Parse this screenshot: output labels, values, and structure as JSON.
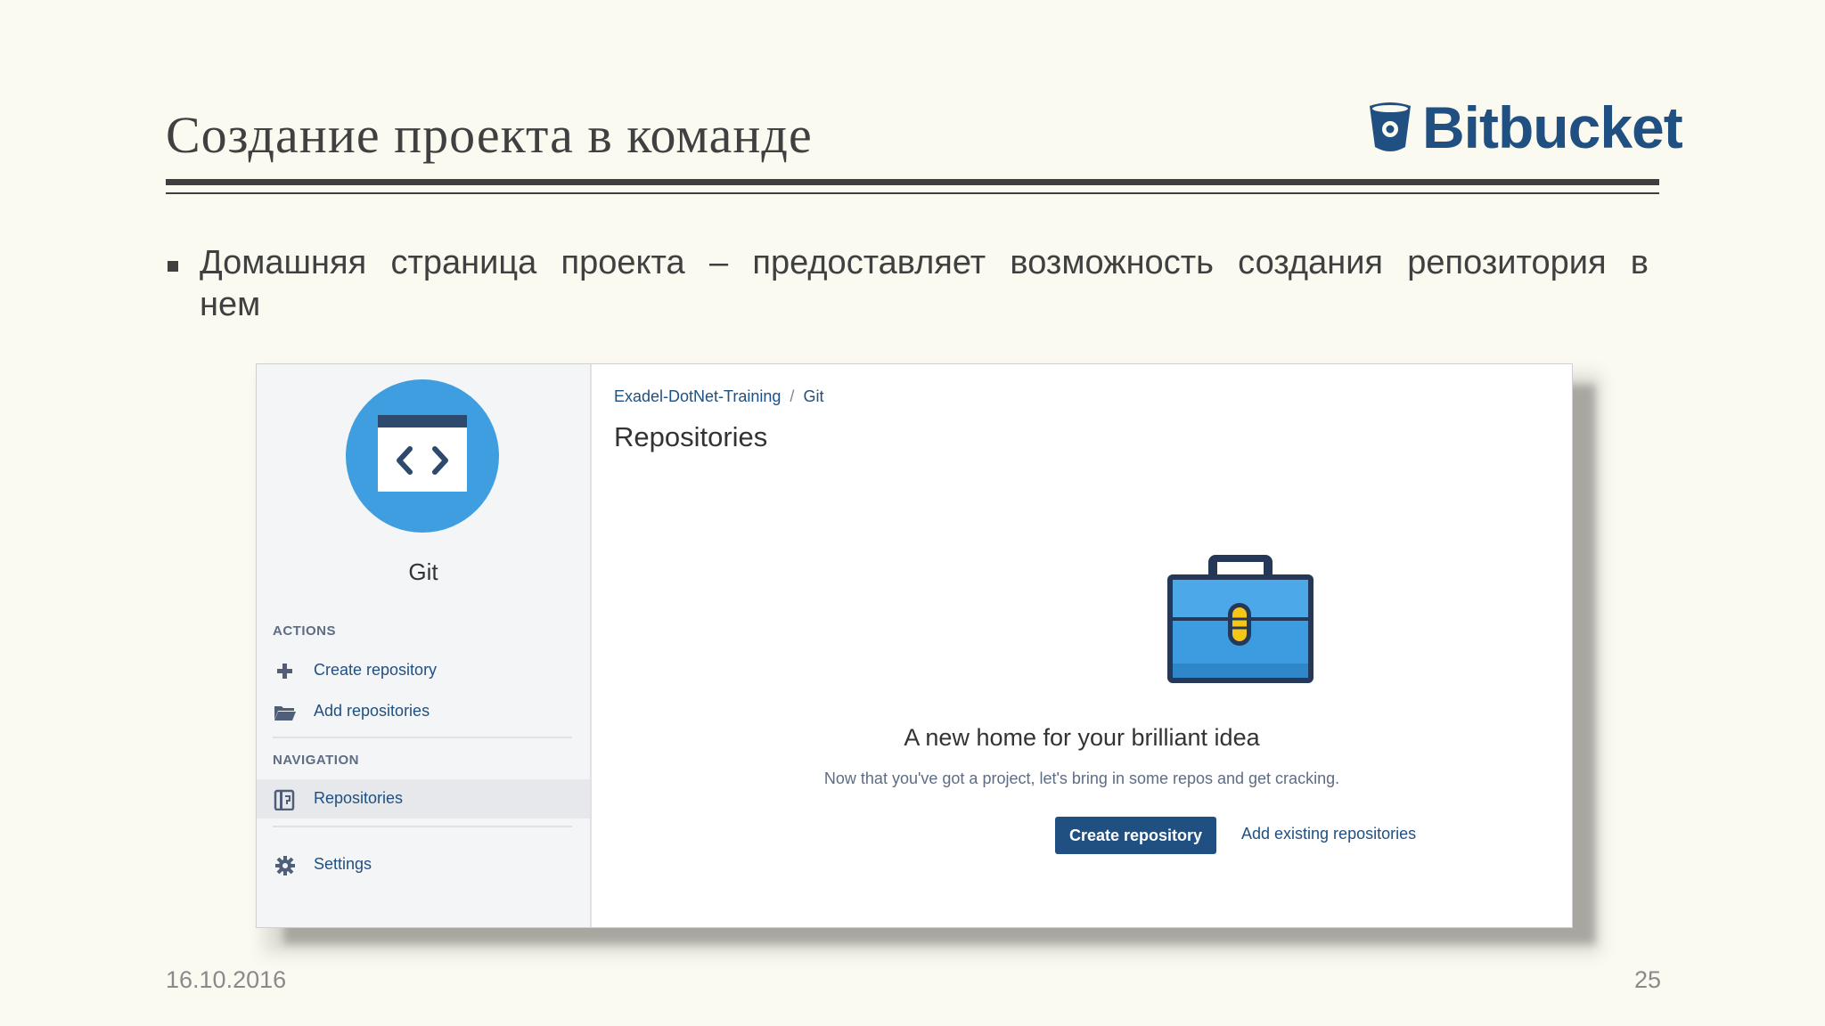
{
  "slide": {
    "title": "Создание проекта в команде",
    "logo_text": "Bitbucket",
    "bullet": "Домашняя страница проекта – предоставляет возможность создания репозитория в нем",
    "date": "16.10.2016",
    "page_number": "25"
  },
  "colors": {
    "brand_blue": "#205081",
    "avatar_blue": "#3f9ee0",
    "slide_background": "#fbfaf1"
  },
  "screenshot": {
    "sidebar": {
      "project_name": "Git",
      "avatar_icon": "code-folder-icon",
      "actions_heading": "ACTIONS",
      "actions": [
        {
          "label": "Create repository",
          "icon": "plus-icon"
        },
        {
          "label": "Add repositories",
          "icon": "folder-open-icon"
        }
      ],
      "navigation_heading": "NAVIGATION",
      "navigation": [
        {
          "label": "Repositories",
          "icon": "repository-icon",
          "active": true
        }
      ],
      "settings": {
        "label": "Settings",
        "icon": "gear-icon"
      }
    },
    "main": {
      "breadcrumb": [
        "Exadel-DotNet-Training",
        "Git"
      ],
      "breadcrumb_separator": "/",
      "title": "Repositories",
      "illustration": "briefcase-icon",
      "empty_heading": "A new home for your brilliant idea",
      "empty_description": "Now that you've got a project, let's bring in some repos and get cracking.",
      "primary_button": "Create repository",
      "secondary_link": "Add existing repositories"
    }
  }
}
